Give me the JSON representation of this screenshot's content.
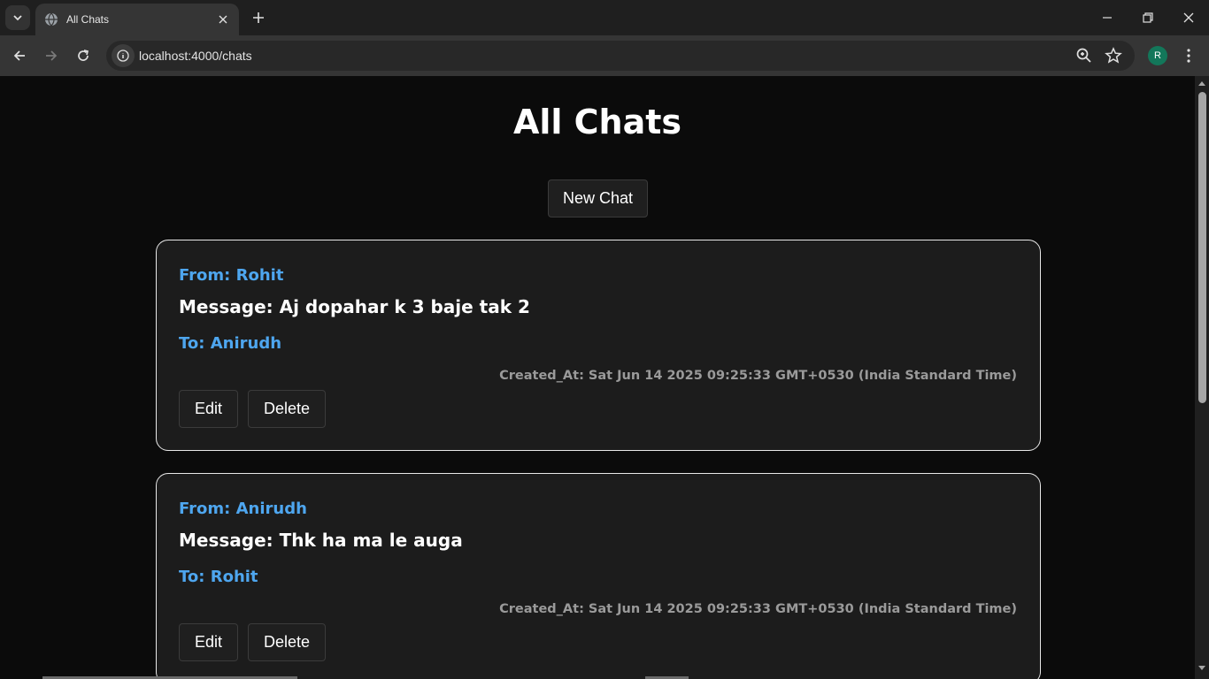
{
  "browser": {
    "tab_title": "All Chats",
    "url": "localhost:4000/chats",
    "profile_initial": "R"
  },
  "icons": {
    "tab_menu": "chevron-down-icon",
    "tab_favicon": "globe-icon",
    "tab_close": "close-icon",
    "new_tab": "plus-icon",
    "minimize": "minimize-icon",
    "restore": "restore-icon",
    "close_window": "close-icon",
    "back": "arrow-left-icon",
    "forward": "arrow-right-icon",
    "reload": "reload-icon",
    "site_info": "info-icon",
    "zoom": "zoom-icon",
    "bookmark": "star-icon",
    "menu": "kebab-icon"
  },
  "page": {
    "title": "All Chats",
    "new_chat_label": "New Chat"
  },
  "chats": [
    {
      "from": "From: Rohit",
      "message": "Message: Aj dopahar k 3 baje tak 2",
      "to": "To: Anirudh",
      "created_at": "Created_At: Sat Jun 14 2025 09:25:33 GMT+0530 (India Standard Time)",
      "edit_label": "Edit",
      "delete_label": "Delete"
    },
    {
      "from": "From: Anirudh",
      "message": "Message: Thk ha ma le auga",
      "to": "To: Rohit",
      "created_at": "Created_At: Sat Jun 14 2025 09:25:33 GMT+0530 (India Standard Time)",
      "edit_label": "Edit",
      "delete_label": "Delete"
    }
  ],
  "colors": {
    "accent": "#4ea6ef",
    "background": "#0b0b0b",
    "card": "#1c1c1c"
  }
}
